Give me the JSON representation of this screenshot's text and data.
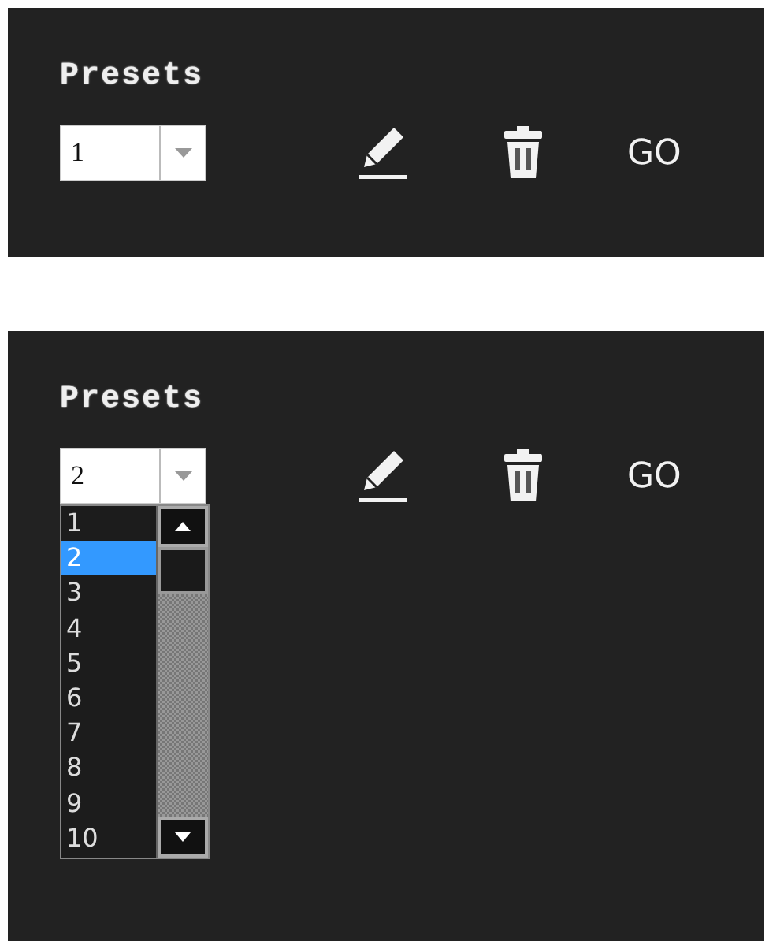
{
  "panels": [
    {
      "title": "Presets",
      "select": {
        "value": "1"
      },
      "go_label": "GO"
    },
    {
      "title": "Presets",
      "select": {
        "value": "2",
        "options": [
          {
            "label": "1",
            "selected": false
          },
          {
            "label": "2",
            "selected": true
          },
          {
            "label": "3",
            "selected": false
          },
          {
            "label": "4",
            "selected": false
          },
          {
            "label": "5",
            "selected": false
          },
          {
            "label": "6",
            "selected": false
          },
          {
            "label": "7",
            "selected": false
          },
          {
            "label": "8",
            "selected": false
          },
          {
            "label": "9",
            "selected": false
          },
          {
            "label": "10",
            "selected": false
          }
        ]
      },
      "go_label": "GO"
    }
  ]
}
